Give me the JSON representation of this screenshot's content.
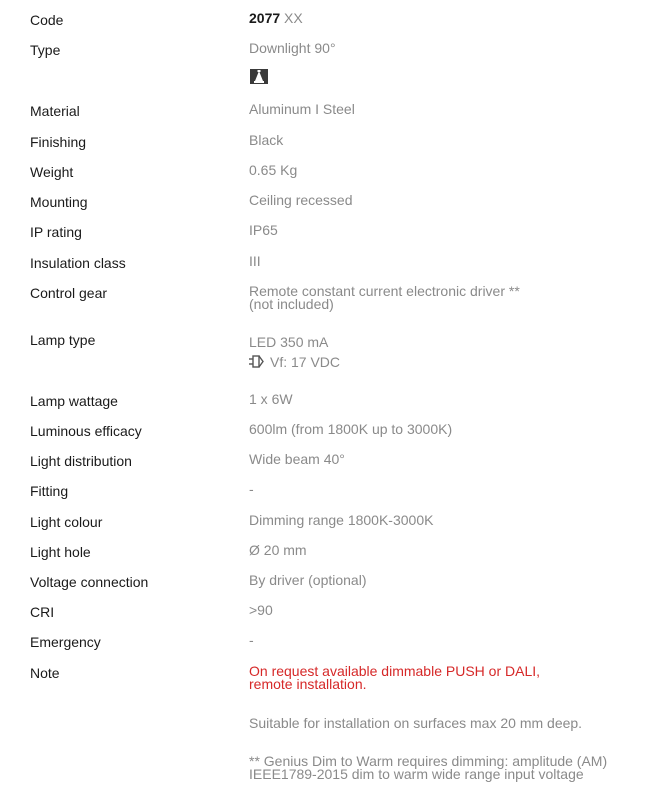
{
  "specs": {
    "code": {
      "label": "Code",
      "value_bold": "2077",
      "value_rest": "XX"
    },
    "type": {
      "label": "Type",
      "value": "Downlight 90°",
      "icon": "downlight-icon"
    },
    "material": {
      "label": "Material",
      "value": "Aluminum I Steel"
    },
    "finishing": {
      "label": "Finishing",
      "value": "Black"
    },
    "weight": {
      "label": "Weight",
      "value": "0.65 Kg"
    },
    "mounting": {
      "label": "Mounting",
      "value": "Ceiling recessed"
    },
    "ip_rating": {
      "label": "IP rating",
      "value": "IP65"
    },
    "insulation_class": {
      "label": "Insulation class",
      "value": "III"
    },
    "control_gear": {
      "label": "Control gear",
      "value_line1": "Remote constant current electronic driver **",
      "value_line2": "(not included)"
    },
    "lamp_type": {
      "label": "Lamp type",
      "value_line1": "LED 350 mA",
      "value_line2": "Vf: 17 VDC",
      "icon": "driver-plug-icon"
    },
    "lamp_wattage": {
      "label": "Lamp wattage",
      "value": "1 x 6W"
    },
    "luminous_efficacy": {
      "label": "Luminous efficacy",
      "value": "600lm (from 1800K up to 3000K)"
    },
    "light_distribution": {
      "label": "Light distribution",
      "value": "Wide beam 40°"
    },
    "fitting": {
      "label": "Fitting",
      "value": "-"
    },
    "light_colour": {
      "label": "Light colour",
      "value": "Dimming range 1800K-3000K"
    },
    "light_hole": {
      "label": "Light hole",
      "value": "Ø 20 mm"
    },
    "voltage_connection": {
      "label": "Voltage connection",
      "value": "By driver (optional)"
    },
    "cri": {
      "label": "CRI",
      "value": ">90"
    },
    "emergency": {
      "label": "Emergency",
      "value": "-"
    },
    "note": {
      "label": "Note",
      "red_line1": "On request available dimmable PUSH or DALI,",
      "red_line2": "remote installation.",
      "para2": "Suitable for installation on surfaces max 20 mm deep.",
      "para3_line1": "** Genius Dim to Warm requires dimming: amplitude (AM)",
      "para3_line2": "IEEE1789-2015 dim to warm wide range input voltage"
    }
  },
  "colors": {
    "label": "#1a1a1a",
    "value": "#8a8a8a",
    "note_red": "#d62828"
  }
}
